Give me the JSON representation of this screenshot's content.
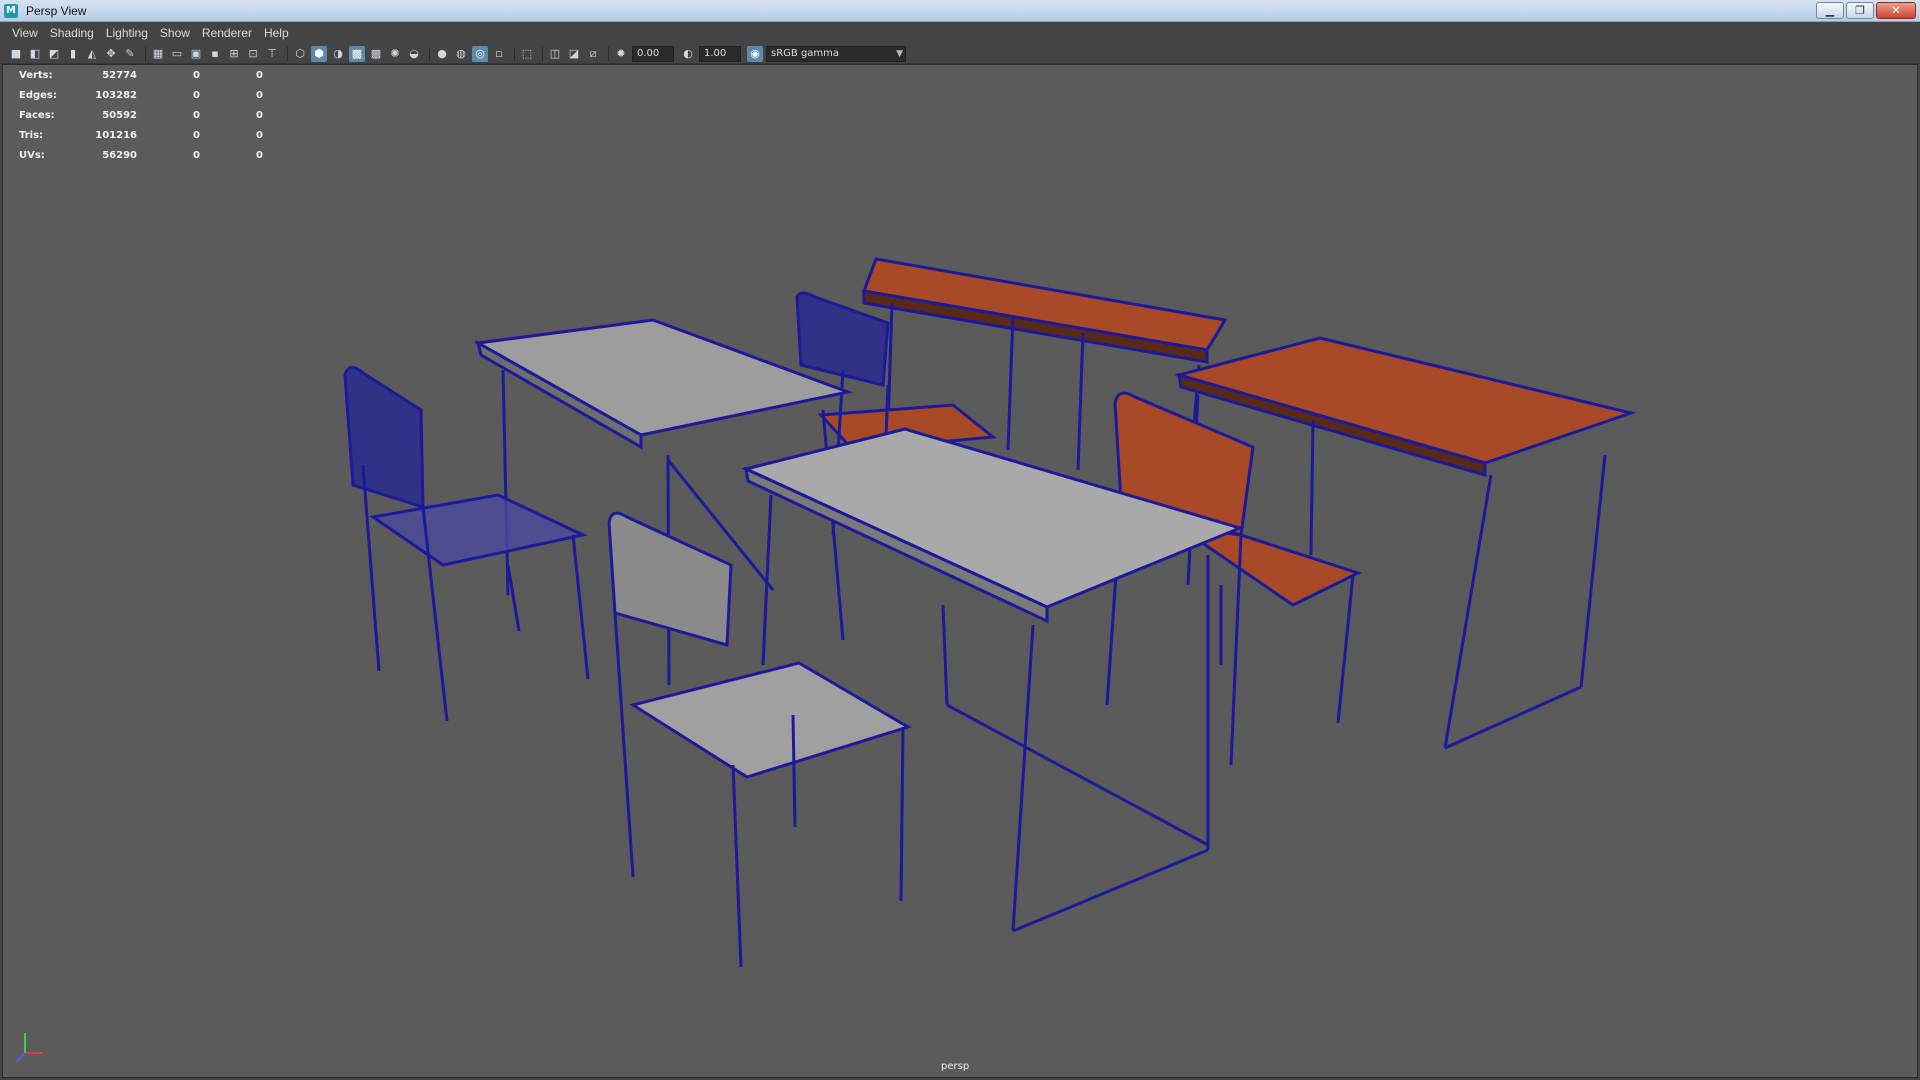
{
  "window": {
    "title": "Persp View",
    "app_icon": "M",
    "controls": [
      "minimize",
      "restore",
      "close"
    ]
  },
  "menu": [
    "View",
    "Shading",
    "Lighting",
    "Show",
    "Renderer",
    "Help"
  ],
  "toolbar": {
    "exposure": "0.00",
    "gamma": "1.00",
    "color_space": "sRGB gamma"
  },
  "hud": {
    "rows": [
      {
        "label": "Verts:",
        "value": "52774",
        "a": "0",
        "b": "0"
      },
      {
        "label": "Edges:",
        "value": "103282",
        "a": "0",
        "b": "0"
      },
      {
        "label": "Faces:",
        "value": "50592",
        "a": "0",
        "b": "0"
      },
      {
        "label": "Tris:",
        "value": "101216",
        "a": "0",
        "b": "0"
      },
      {
        "label": "UVs:",
        "value": "56290",
        "a": "0",
        "b": "0"
      }
    ]
  },
  "viewport": {
    "camera": "persp",
    "background": "#5b5b5b",
    "wire_color": "#1c1a9a",
    "wood_color": "#a9492a",
    "grey_top": "#a9a9a9"
  },
  "icons": [
    "camera-icon",
    "select-camera-icon",
    "lock-camera-icon",
    "bookmark-icon",
    "grid-icon",
    "wireframe-icon",
    "smooth-shade-icon",
    "light-icon",
    "isolate-icon",
    "exposure-icon",
    "gamma-icon",
    "color-mgmt-icon",
    "axis-gizmo-icon"
  ]
}
